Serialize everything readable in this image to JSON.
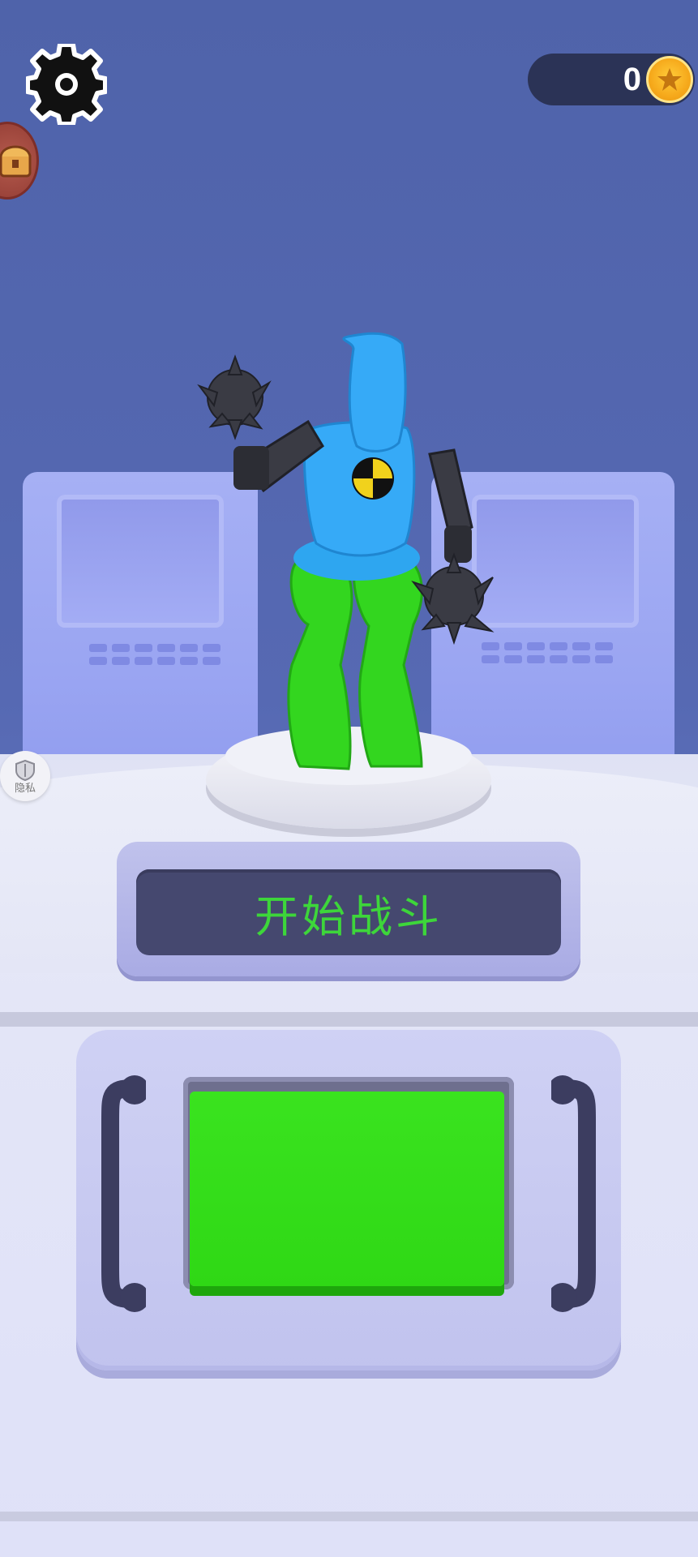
{
  "hud": {
    "settings_icon": "gear-icon",
    "coins": "0",
    "coin_icon": "gold-star-coin-icon",
    "chest_icon": "treasure-chest-icon",
    "privacy_icon": "shield-icon",
    "privacy_label": "隐私"
  },
  "main": {
    "start_battle_label": "开始战斗",
    "character": "crash-test-dummy-fighter",
    "colors": {
      "background": "#5669b3",
      "accent_green": "#33dd18",
      "label_green": "#3dd63a",
      "panel_dark": "#45486f",
      "coin_gold": "#f6a91b"
    }
  }
}
